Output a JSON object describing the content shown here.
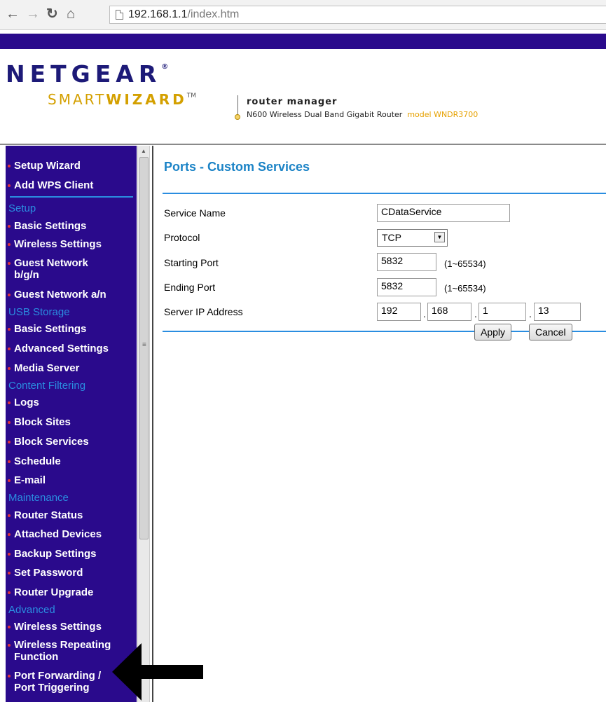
{
  "browser": {
    "url_host": "192.168.1.1",
    "url_path": "/index.htm"
  },
  "header": {
    "brand": "NETGEAR",
    "brand_mark": "®",
    "smart": "SMART",
    "wizard": "WIZARD",
    "tm": "TM",
    "router_manager": "router manager",
    "router_desc": "N600 Wireless Dual Band Gigabit Router",
    "model": "model WNDR3700"
  },
  "sidebar": {
    "top_items": [
      "Setup Wizard",
      "Add WPS Client"
    ],
    "sections": {
      "setup": "Setup",
      "usb": "USB Storage",
      "content": "Content Filtering",
      "maintenance": "Maintenance",
      "advanced": "Advanced"
    },
    "items": {
      "basic_settings": "Basic Settings",
      "wireless_settings": "Wireless Settings",
      "guest_bgn_1": "Guest Network",
      "guest_bgn_2": "b/g/n",
      "guest_an": "Guest Network a/n",
      "usb_basic": "Basic Settings",
      "usb_advanced": "Advanced Settings",
      "media_server": "Media Server",
      "logs": "Logs",
      "block_sites": "Block Sites",
      "block_services": "Block Services",
      "schedule": "Schedule",
      "email": "E-mail",
      "router_status": "Router Status",
      "attached_devices": "Attached Devices",
      "backup_settings": "Backup Settings",
      "set_password": "Set Password",
      "router_upgrade": "Router Upgrade",
      "adv_wireless": "Wireless Settings",
      "wireless_repeating_1": "Wireless Repeating",
      "wireless_repeating_2": "Function",
      "port_forwarding_1": "Port Forwarding /",
      "port_forwarding_2": "Port Triggering"
    }
  },
  "main": {
    "title": "Ports - Custom Services",
    "labels": {
      "service_name": "Service Name",
      "protocol": "Protocol",
      "starting_port": "Starting Port",
      "ending_port": "Ending Port",
      "server_ip": "Server IP Address"
    },
    "values": {
      "service_name": "CDataService",
      "protocol": "TCP",
      "starting_port": "5832",
      "ending_port": "5832",
      "ip_1": "192",
      "ip_2": "168",
      "ip_3": "1",
      "ip_4": "13"
    },
    "port_hint": "(1~65534)",
    "apply": "Apply",
    "cancel": "Cancel"
  }
}
